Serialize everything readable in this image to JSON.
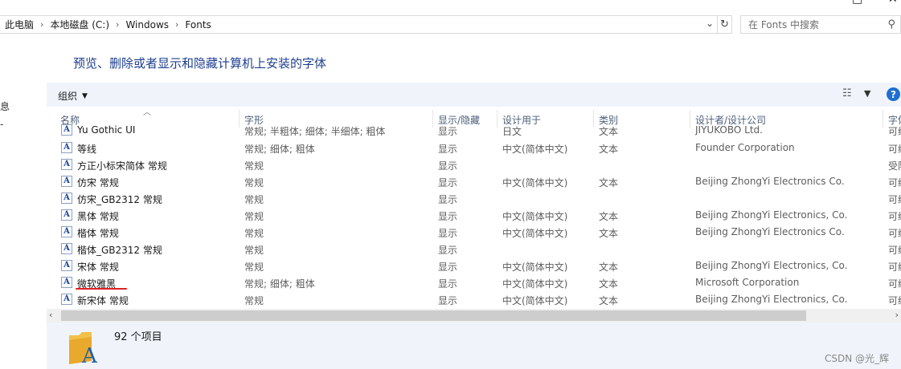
{
  "window": {
    "minimize_icon": "minimize-icon",
    "close_icon": "close-icon"
  },
  "address_bar": {
    "crumbs": [
      "此电脑",
      "本地磁盘 (C:)",
      "Windows",
      "Fonts"
    ]
  },
  "search": {
    "placeholder": "在 Fonts 中搜索"
  },
  "page_title": "预览、删除或者显示和隐藏计算机上安装的字体",
  "left_pane_fragments": [
    "息",
    "-"
  ],
  "toolbar": {
    "organize_label": "组织"
  },
  "columns": [
    "名称",
    "字形",
    "显示/隐藏",
    "设计用于",
    "类别",
    "设计者/设计公司",
    "字体"
  ],
  "rows": [
    {
      "name": "Yu Gothic UI",
      "style": "常规; 半粗体; 细体; 半细体; 粗体",
      "show": "显示",
      "designed": "日文",
      "category": "文本",
      "designer": "JIYUKOBO Ltd.",
      "extra": "可编"
    },
    {
      "name": "等线",
      "style": "常规; 细体; 粗体",
      "show": "显示",
      "designed": "中文(简体中文)",
      "category": "文本",
      "designer": "Founder Corporation",
      "extra": "可编"
    },
    {
      "name": "方正小标宋简体 常规",
      "style": "常规",
      "show": "显示",
      "designed": "",
      "category": "",
      "designer": "",
      "extra": "受限"
    },
    {
      "name": "仿宋 常规",
      "style": "常规",
      "show": "显示",
      "designed": "中文(简体中文)",
      "category": "文本",
      "designer": "Beijing ZhongYi Electronics Co.",
      "extra": "可编"
    },
    {
      "name": "仿宋_GB2312 常规",
      "style": "常规",
      "show": "显示",
      "designed": "",
      "category": "",
      "designer": "",
      "extra": "可编"
    },
    {
      "name": "黑体 常规",
      "style": "常规",
      "show": "显示",
      "designed": "中文(简体中文)",
      "category": "文本",
      "designer": "Beijing ZhongYi Electronics, Co.",
      "extra": "可编"
    },
    {
      "name": "楷体 常规",
      "style": "常规",
      "show": "显示",
      "designed": "中文(简体中文)",
      "category": "文本",
      "designer": "Beijing ZhongYi Electronics Co.",
      "extra": "可编"
    },
    {
      "name": "楷体_GB2312 常规",
      "style": "常规",
      "show": "显示",
      "designed": "",
      "category": "",
      "designer": "",
      "extra": "可编"
    },
    {
      "name": "宋体 常规",
      "style": "常规",
      "show": "显示",
      "designed": "中文(简体中文)",
      "category": "文本",
      "designer": "Beijing ZhongYi Electronics, Co.",
      "extra": "可编"
    },
    {
      "name": "微软雅黑",
      "style": "常规; 细体; 粗体",
      "show": "显示",
      "designed": "中文(简体中文)",
      "category": "文本",
      "designer": "Microsoft Corporation",
      "extra": "可编"
    },
    {
      "name": "新宋体 常规",
      "style": "常规",
      "show": "显示",
      "designed": "中文(简体中文)",
      "category": "文本",
      "designer": "Beijing ZhongYi Electronics, Co.",
      "extra": "可编"
    }
  ],
  "status": {
    "item_count": "92 个项目"
  },
  "watermark": "CSDN @光_辉",
  "colors": {
    "title_blue": "#1e3f8f",
    "toolbar_bg": "#f0f4fa",
    "help_blue": "#1f6fd1",
    "annotation_red": "#e02020"
  }
}
